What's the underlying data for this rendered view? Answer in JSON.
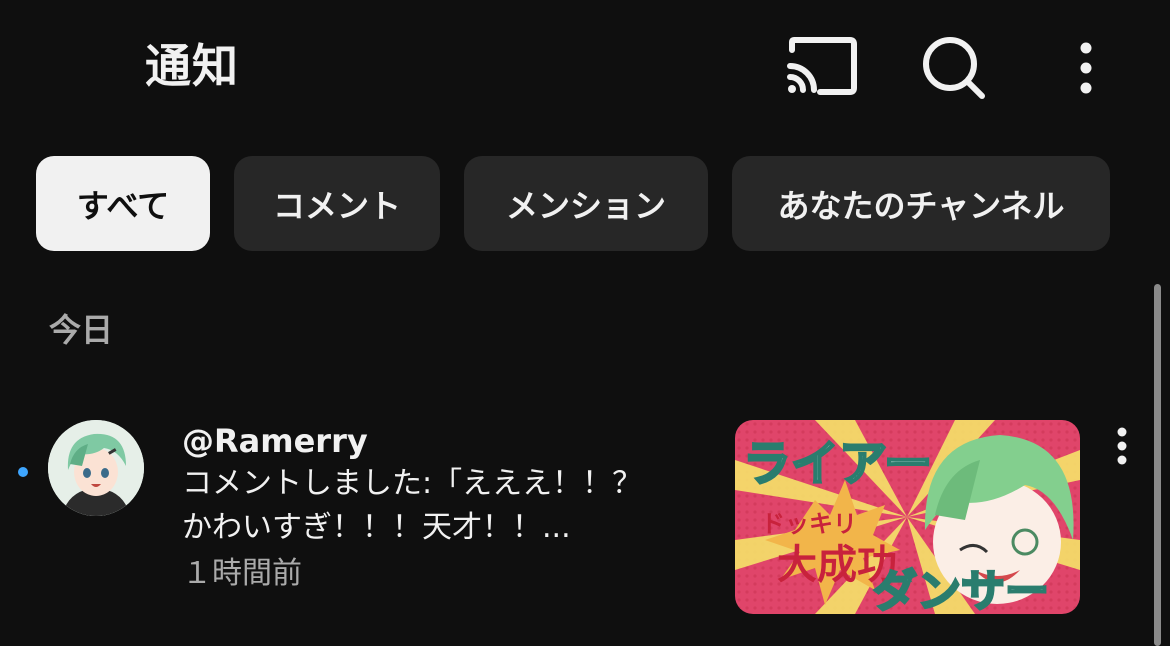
{
  "header": {
    "title": "通知",
    "icons": [
      "cast-icon",
      "search-icon",
      "more-vertical-icon"
    ]
  },
  "chips": [
    {
      "label": "すべて",
      "selected": true
    },
    {
      "label": "コメント",
      "selected": false
    },
    {
      "label": "メンション",
      "selected": false
    },
    {
      "label": "あなたのチャンネル",
      "selected": false
    }
  ],
  "section": {
    "today": "今日"
  },
  "notification": {
    "user": "@Ramerry",
    "body_line1": "コメントしました:「えええ！！？",
    "body_line2": "かわいすぎ！！！天才！！...",
    "time": "１時間前",
    "unread": true,
    "thumbnail": {
      "title_text": "ライアーダンサー",
      "sub_text": "ドッキリ大成功"
    }
  },
  "colors": {
    "background": "#0f0f0f",
    "chip_bg": "#272727",
    "chip_active_bg": "#f1f1f1",
    "text_primary": "#f1f1f1",
    "text_secondary": "#aaaaaa",
    "unread_dot": "#3ea6ff"
  }
}
